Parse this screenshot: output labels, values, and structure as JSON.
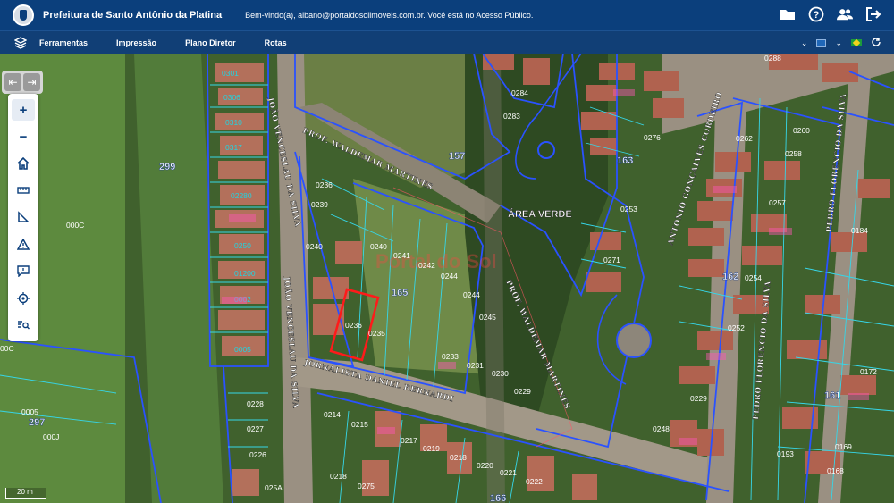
{
  "header": {
    "title": "Prefeitura de Santo Antônio da Platina",
    "welcome": "Bem-vindo(a), albano@portaldosolimoveis.com.br. Você está no Acesso Público.",
    "icons": [
      "folder-icon",
      "help-icon",
      "users-icon",
      "logout-icon"
    ]
  },
  "menu": {
    "items": [
      "Ferramentas",
      "Impressão",
      "Plano Diretor",
      "Rotas"
    ]
  },
  "controls": {
    "prev_label": "⇤",
    "next_label": "⇥"
  },
  "map": {
    "scale_label": "20 m",
    "blocks": [
      "157",
      "163",
      "165",
      "162",
      "161",
      "166",
      "297",
      "299"
    ],
    "area_label": "ÁREA VERDE",
    "streets": {
      "s1": "PROF. WALDEMAR MARTINES",
      "s2": "JOÃO VENCESLAU DA SILVA",
      "s3": "JOÃO VENCESLAU DA SILVA",
      "s4": "JORNALISTA DANIEL BERNARDI",
      "s5": "PROF. WALDEMAR MARTINES",
      "s6": "ANTONIO GONÇALVES CORDEIRO",
      "s7": "PEDRO FLORENCIO DA SILVA",
      "s8": "PEDRO FLORENCIO DA SILVA"
    },
    "lots_white": [
      "0236",
      "0239",
      "0240",
      "0240",
      "0241",
      "0242",
      "0244",
      "0244",
      "0245",
      "0236",
      "0235",
      "0233",
      "0231",
      "0230",
      "0229",
      "0214",
      "0215",
      "0217",
      "0218",
      "0219",
      "0220",
      "0221",
      "0222",
      "0218",
      "0275",
      "0284",
      "0283",
      "0276",
      "0262",
      "0260",
      "0258",
      "0257",
      "0253",
      "0271",
      "0254",
      "0252",
      "0229",
      "0248",
      "0193",
      "0169",
      "0168",
      "0172",
      "0184",
      "0288",
      "0228",
      "0227",
      "0226",
      "025A",
      "000C",
      "0005",
      "00C",
      "000J"
    ],
    "lots_cyan": [
      "0301",
      "0306",
      "0310",
      "0317",
      "02280",
      "0250",
      "01200",
      "0002",
      "0005"
    ]
  }
}
